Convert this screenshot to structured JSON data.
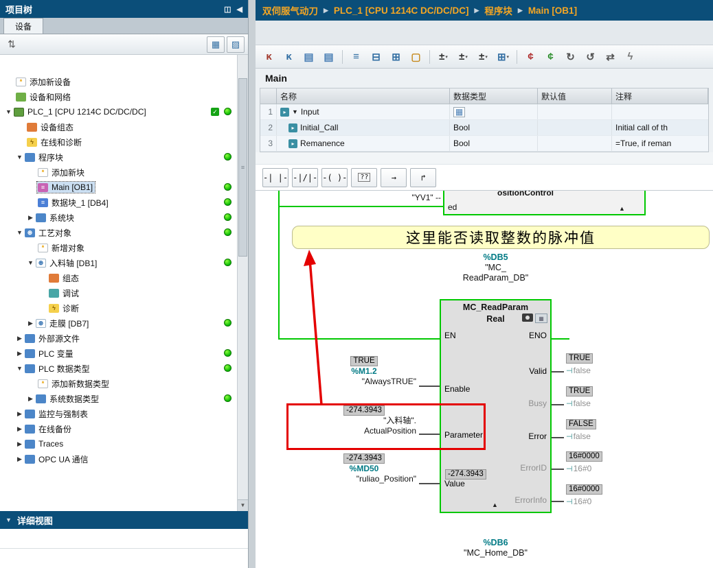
{
  "colors": {
    "header_blue": "#0B4E79",
    "breadcrumb_orange": "#F5A623",
    "monitor_green": "#00C800",
    "annotation_red": "#E40000",
    "address_teal": "#007A85",
    "comment_yellow": "#FFFFC6"
  },
  "left_panel": {
    "title": "项目树",
    "window_icons": [
      {
        "name": "float-window-icon",
        "glyph": "◫"
      },
      {
        "name": "collapse-panel-icon",
        "glyph": "◀"
      }
    ],
    "tab": "设备",
    "toolbar": {
      "left": [
        {
          "name": "sort-icon",
          "glyph": "⇅"
        }
      ],
      "right": [
        {
          "name": "overview-icon",
          "glyph": "▦"
        },
        {
          "name": "layout-options-icon",
          "glyph": "▨"
        }
      ]
    },
    "details_title": "详细视图",
    "tree": [
      {
        "label": "添加新设备",
        "level": 1,
        "icon": "add-device",
        "name": "tree-item-add-new-device"
      },
      {
        "label": "设备和网络",
        "level": 1,
        "icon": "devices-networks",
        "name": "tree-item-devices-and-networks"
      },
      {
        "label": "PLC_1 [CPU 1214C DC/DC/DC]",
        "level": 0,
        "arrow": "down",
        "icon": "plc",
        "check": true,
        "dot": true,
        "name": "tree-item-plc-1"
      },
      {
        "label": "设备组态",
        "level": 2,
        "icon": "device-config",
        "name": "tree-item-device-configuration"
      },
      {
        "label": "在线和诊断",
        "level": 2,
        "icon": "online-diagnostics",
        "name": "tree-item-online-and-diagnostics"
      },
      {
        "label": "程序块",
        "level": 1,
        "arrow": "down",
        "icon": "folder",
        "dot": true,
        "name": "tree-item-program-blocks"
      },
      {
        "label": "添加新块",
        "level": 3,
        "icon": "add-block",
        "name": "tree-item-add-new-block"
      },
      {
        "label": "Main [OB1]",
        "level": 3,
        "icon": "ob-block",
        "dot": true,
        "selected": true,
        "name": "tree-item-main-ob1"
      },
      {
        "label": "数据块_1 [DB4]",
        "level": 3,
        "icon": "db-block",
        "dot": true,
        "name": "tree-item-data-block-1-db4"
      },
      {
        "label": "系统块",
        "level": 2,
        "arrow": "right",
        "icon": "folder",
        "dot": true,
        "name": "tree-item-system-blocks"
      },
      {
        "label": "工艺对象",
        "level": 1,
        "arrow": "down",
        "icon": "folder-tech",
        "dot": true,
        "name": "tree-item-technology-objects"
      },
      {
        "label": "新增对象",
        "level": 3,
        "icon": "add-object",
        "name": "tree-item-add-new-object"
      },
      {
        "label": "入料轴 [DB1]",
        "level": 2,
        "arrow": "down",
        "icon": "axis",
        "dot": true,
        "name": "tree-item-infeed-axis-db1"
      },
      {
        "label": "组态",
        "level": 4,
        "icon": "config",
        "name": "tree-item-configuration"
      },
      {
        "label": "调试",
        "level": 4,
        "icon": "commissioning",
        "name": "tree-item-commissioning"
      },
      {
        "label": "诊断",
        "level": 4,
        "icon": "diagnostics",
        "name": "tree-item-diagnostics"
      },
      {
        "label": "走膜 [DB7]",
        "level": 2,
        "arrow": "right",
        "icon": "axis",
        "dot": true,
        "name": "tree-item-film-axis-db7"
      },
      {
        "label": "外部源文件",
        "level": 1,
        "arrow": "right",
        "icon": "folder",
        "name": "tree-item-external-source-files"
      },
      {
        "label": "PLC 变量",
        "level": 1,
        "arrow": "right",
        "icon": "folder-tags",
        "dot": true,
        "name": "tree-item-plc-tags"
      },
      {
        "label": "PLC 数据类型",
        "level": 1,
        "arrow": "down",
        "icon": "folder-types",
        "dot": true,
        "name": "tree-item-plc-data-types"
      },
      {
        "label": "添加新数据类型",
        "level": 3,
        "icon": "add-type",
        "name": "tree-item-add-new-data-type"
      },
      {
        "label": "系统数据类型",
        "level": 2,
        "arrow": "right",
        "icon": "folder",
        "dot": true,
        "name": "tree-item-system-data-types"
      },
      {
        "label": "监控与强制表",
        "level": 1,
        "arrow": "right",
        "icon": "folder-watch",
        "name": "tree-item-watch-and-force-tables"
      },
      {
        "label": "在线备份",
        "level": 1,
        "arrow": "right",
        "icon": "folder-backup",
        "name": "tree-item-online-backups"
      },
      {
        "label": "Traces",
        "level": 1,
        "arrow": "right",
        "icon": "folder-traces",
        "name": "tree-item-traces"
      },
      {
        "label": "OPC UA 通信",
        "level": 1,
        "arrow": "right",
        "icon": "folder-opcua",
        "name": "tree-item-opc-ua-communication"
      }
    ]
  },
  "breadcrumb": {
    "separator": "▶",
    "items": [
      "双伺服气动刀",
      "PLC_1 [CPU 1214C DC/DC/DC]",
      "程序块",
      "Main [OB1]"
    ]
  },
  "editor_toolbar": [
    {
      "name": "absolute-operands-icon",
      "glyph": "κ",
      "color": "#A33A2E"
    },
    {
      "name": "symbolic-operands-icon",
      "glyph": "κ",
      "color": "#336FA3"
    },
    {
      "name": "insert-row-before-icon",
      "glyph": "▤",
      "color": "#4A7FB5"
    },
    {
      "name": "insert-row-after-icon",
      "glyph": "▤",
      "color": "#4A7FB5"
    },
    {
      "sep": true
    },
    {
      "name": "open-all-networks-icon",
      "glyph": "≡",
      "color": "#336FA3"
    },
    {
      "name": "close-all-networks-icon",
      "glyph": "⊟",
      "color": "#336FA3"
    },
    {
      "name": "expand-all-networks-icon",
      "glyph": "⊞",
      "color": "#336FA3"
    },
    {
      "name": "network-comments-toggle-icon",
      "glyph": "▢",
      "color": "#C68A1E"
    },
    {
      "sep": true
    },
    {
      "name": "display-format-1-icon",
      "glyph": "±",
      "color": "#333333",
      "caret": true
    },
    {
      "name": "display-format-2-icon",
      "glyph": "±",
      "color": "#333333",
      "caret": true
    },
    {
      "name": "display-format-3-icon",
      "glyph": "±",
      "color": "#333333",
      "caret": true
    },
    {
      "name": "split-editor-icon",
      "glyph": "⊞",
      "color": "#336FA3",
      "caret": true
    },
    {
      "sep": true
    },
    {
      "name": "monitoring-on-icon",
      "glyph": "¢",
      "color": "#B03030"
    },
    {
      "name": "monitoring-off-icon",
      "glyph": "¢",
      "color": "#2F8F2F"
    },
    {
      "name": "update-calls-icon",
      "glyph": "↻",
      "color": "#555555"
    },
    {
      "name": "snapshot-values-icon",
      "glyph": "↺",
      "color": "#555555"
    },
    {
      "name": "compare-values-icon",
      "glyph": "⇄",
      "color": "#555555"
    },
    {
      "name": "start-values-icon",
      "glyph": "ϟ",
      "color": "#777777"
    }
  ],
  "interface": {
    "title": "Main",
    "headers": [
      "名称",
      "数据类型",
      "默认值",
      "注释"
    ],
    "rows": [
      {
        "num": "1",
        "icon": "section",
        "expander": "▼",
        "name": "Input",
        "datatype": "",
        "datatype_icon": true,
        "default": "",
        "comment": ""
      },
      {
        "num": "2",
        "icon": "var-in",
        "name": "Initial_Call",
        "datatype": "Bool",
        "default": "",
        "comment": "Initial call of th"
      },
      {
        "num": "3",
        "icon": "var-in",
        "name": "Remanence",
        "datatype": "Bool",
        "default": "",
        "comment": "=True, if reman"
      }
    ]
  },
  "lad_favorites": [
    {
      "name": "no-contact-button",
      "label": "-| |-"
    },
    {
      "name": "nc-contact-button",
      "label": "-|/|-"
    },
    {
      "name": "coil-button",
      "label": "-( )-"
    },
    {
      "name": "empty-box-button",
      "label": "??",
      "boxed": true
    },
    {
      "name": "open-branch-button",
      "label": "→"
    },
    {
      "name": "close-branch-button",
      "label": "↱"
    }
  ],
  "network": {
    "prev_fragment": {
      "operand": "\"YV1\" --",
      "pin_text": "ed",
      "header_text": "ositionControl"
    },
    "comment": "这里能否读取整数的脉冲值",
    "db_header": {
      "address": "%DB5",
      "name_line1": "\"MC_",
      "name_line2": "ReadParam_DB\""
    },
    "block": {
      "title": "MC_ReadParam",
      "subtitle": "Real",
      "en": "EN",
      "eno": "ENO",
      "inputs": [
        {
          "pin": "Enable",
          "monitor": "TRUE",
          "address": "%M1.2",
          "operand": "\"AlwaysTRUE\""
        },
        {
          "pin": "Parameter",
          "monitor": "-274.3943",
          "operand": "\"入料轴\".",
          "operand2": "ActualPosition"
        },
        {
          "pin": "Value",
          "monitor": "-274.3943",
          "address": "%MD50",
          "operand": "\"ruliao_Position\"",
          "inner_monitor": "-274.3943"
        }
      ],
      "outputs": [
        {
          "pin": "Valid",
          "monitor": "TRUE",
          "operand": "false",
          "dim": false
        },
        {
          "pin": "Busy",
          "monitor": "TRUE",
          "operand": "false",
          "dim": true
        },
        {
          "pin": "Error",
          "monitor": "FALSE",
          "operand": "false",
          "dim": false
        },
        {
          "pin": "ErrorID",
          "monitor": "16#0000",
          "operand": "16#0",
          "dim": true
        },
        {
          "pin": "ErrorInfo",
          "monitor": "16#0000",
          "operand": "16#0",
          "dim": true
        }
      ]
    },
    "next_db": {
      "address": "%DB6",
      "name": "\"MC_Home_DB\""
    }
  }
}
